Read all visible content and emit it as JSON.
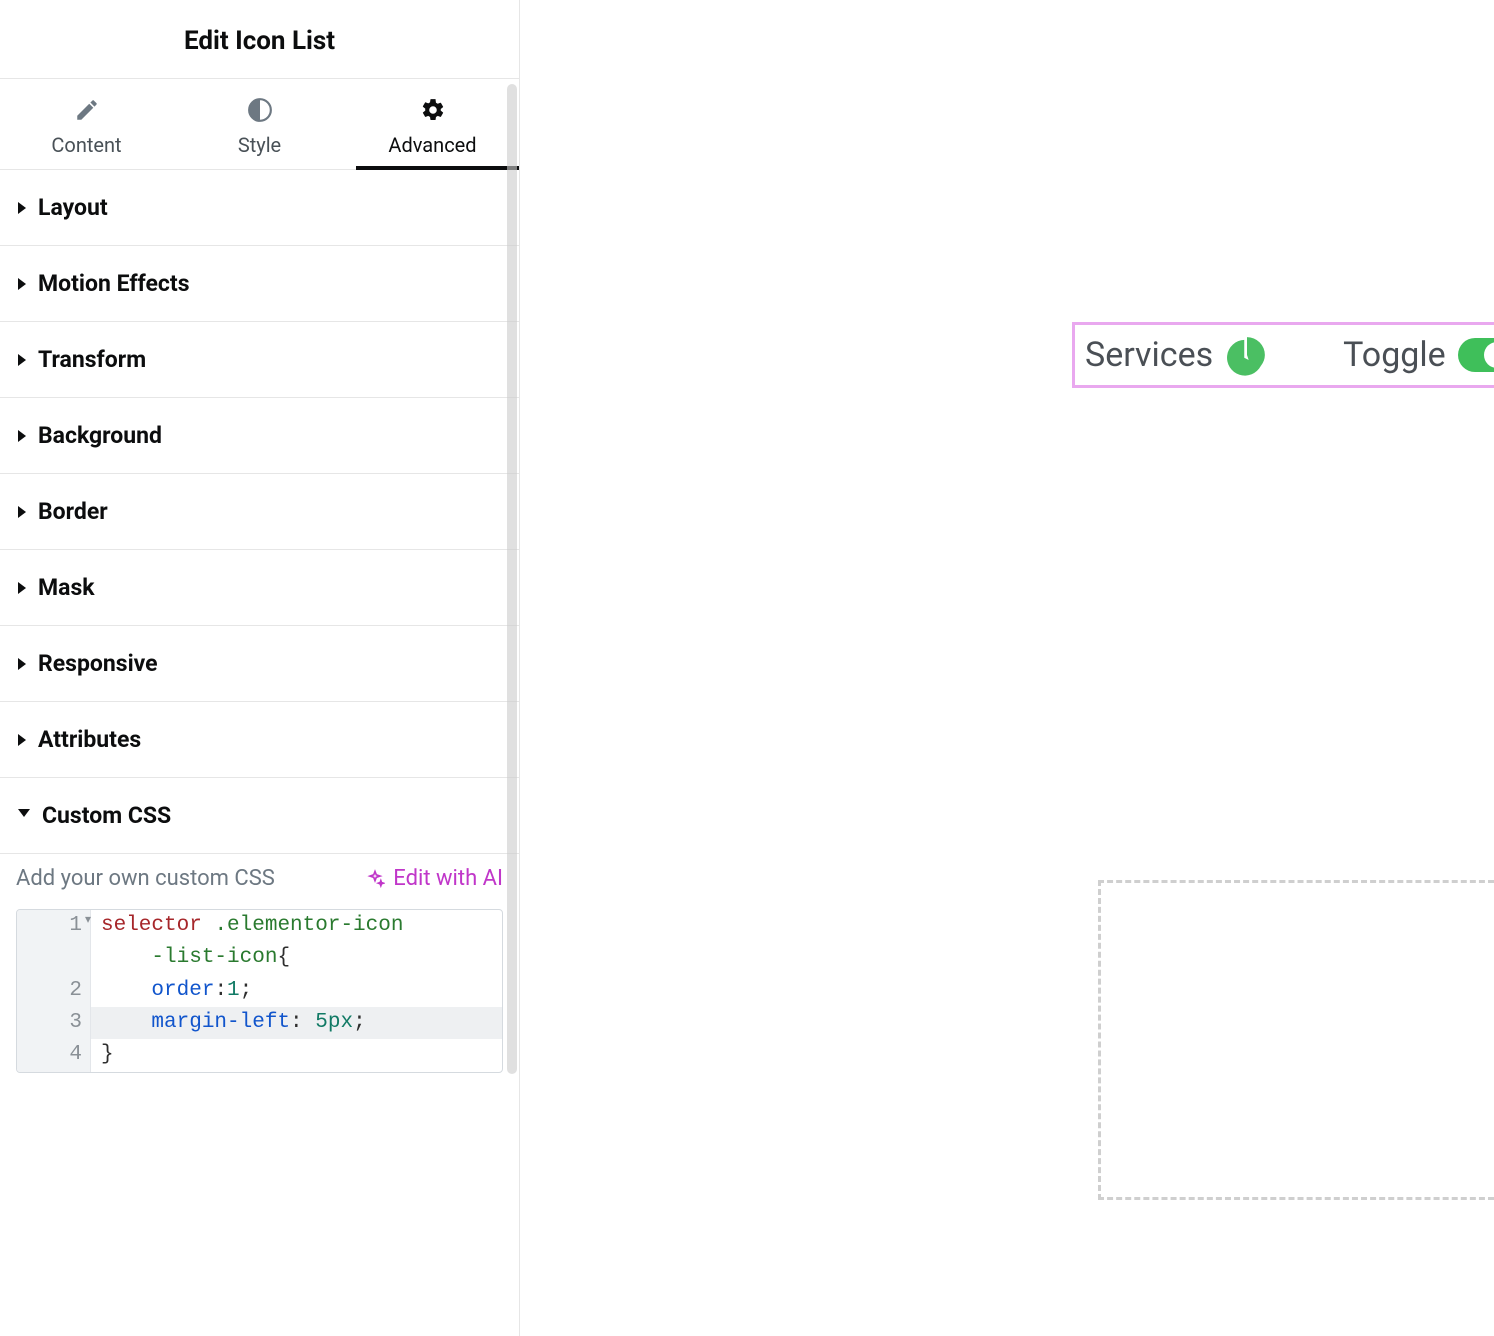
{
  "panel": {
    "title": "Edit Icon List",
    "tabs": [
      {
        "id": "content",
        "label": "Content",
        "active": false
      },
      {
        "id": "style",
        "label": "Style",
        "active": false
      },
      {
        "id": "advanced",
        "label": "Advanced",
        "active": true
      }
    ],
    "sections": [
      {
        "label": "Layout",
        "open": false
      },
      {
        "label": "Motion Effects",
        "open": false
      },
      {
        "label": "Transform",
        "open": false
      },
      {
        "label": "Background",
        "open": false
      },
      {
        "label": "Border",
        "open": false
      },
      {
        "label": "Mask",
        "open": false
      },
      {
        "label": "Responsive",
        "open": false
      },
      {
        "label": "Attributes",
        "open": false
      },
      {
        "label": "Custom CSS",
        "open": true
      }
    ],
    "custom_css": {
      "hint": "Add your own custom CSS",
      "edit_ai_label": "Edit with AI",
      "lines": [
        {
          "n": "1",
          "fold": true,
          "hl": false,
          "tokens": [
            [
              "sel",
              "selector"
            ],
            [
              "punc",
              " "
            ],
            [
              "class",
              ".elementor-icon"
            ]
          ]
        },
        {
          "n": "",
          "fold": false,
          "hl": false,
          "tokens": [
            [
              "punc",
              "    "
            ],
            [
              "class",
              "-list-icon"
            ],
            [
              "punc",
              "{"
            ]
          ]
        },
        {
          "n": "2",
          "fold": false,
          "hl": false,
          "tokens": [
            [
              "punc",
              "    "
            ],
            [
              "prop",
              "order"
            ],
            [
              "punc",
              ":"
            ],
            [
              "num",
              "1"
            ],
            [
              "punc",
              ";"
            ]
          ]
        },
        {
          "n": "3",
          "fold": false,
          "hl": true,
          "tokens": [
            [
              "punc",
              "    "
            ],
            [
              "prop",
              "margin-left"
            ],
            [
              "punc",
              ": "
            ],
            [
              "num",
              "5px"
            ],
            [
              "punc",
              ";"
            ]
          ]
        },
        {
          "n": "4",
          "fold": false,
          "hl": false,
          "tokens": [
            [
              "punc",
              "}"
            ]
          ]
        }
      ]
    }
  },
  "preview": {
    "items": [
      {
        "label": "Services",
        "icon": "pie-chart"
      },
      {
        "label": "Toggle",
        "icon": "toggle-on"
      }
    ]
  },
  "collapse_glyph": "‹"
}
